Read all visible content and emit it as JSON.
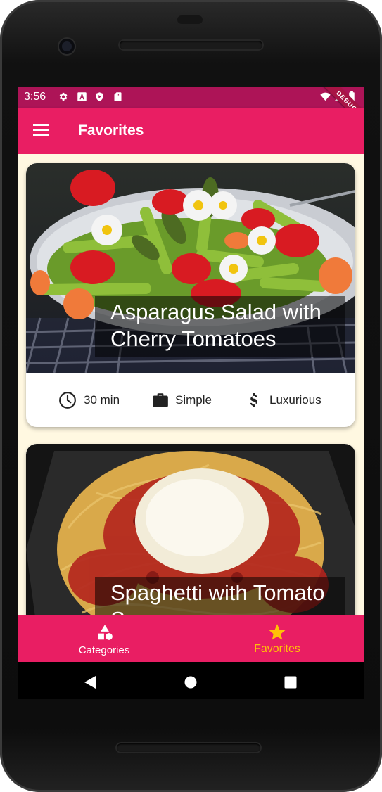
{
  "status_bar": {
    "time": "3:56",
    "debug_label": "DEBUG"
  },
  "app_bar": {
    "title": "Favorites",
    "menu_icon": "menu-icon"
  },
  "meals": [
    {
      "title": "Asparagus Salad with Cherry Tomatoes",
      "duration": "30 min",
      "complexity": "Simple",
      "affordability": "Luxurious"
    },
    {
      "title": "Spaghetti with Tomato Sauce"
    }
  ],
  "bottom_nav": {
    "items": [
      {
        "label": "Categories",
        "icon": "category-icon",
        "selected": false
      },
      {
        "label": "Favorites",
        "icon": "star-icon",
        "selected": true
      }
    ],
    "selected_color": "#ffc107",
    "unselected_color": "#ffffff"
  },
  "colors": {
    "primary": "#e91e63",
    "status_bar": "#ad1457",
    "canvas": "#fff8e1",
    "accent": "#ffc107"
  }
}
